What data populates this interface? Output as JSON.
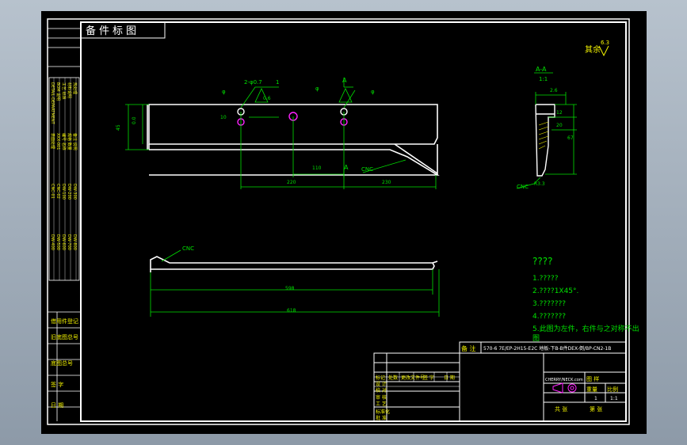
{
  "stamp": {
    "text": "备件标图"
  },
  "roughness": {
    "label": "其余",
    "value": "6.3"
  },
  "section": {
    "title": "A-A",
    "scale": "1:1"
  },
  "dims_top": {
    "d1": "2-φ0.7",
    "d2": "1",
    "tol1": "φ",
    "tol2": "φ",
    "tol3": "φ",
    "sec_a_top": "A",
    "sec_a_bottom": "A",
    "left1": "45",
    "left2": "0.0",
    "hole_v": "10",
    "dim_110": "110",
    "dim_220": "220",
    "dim_230": "230",
    "flat": "0.6",
    "cnc": "CNC"
  },
  "dims_section": {
    "w": "2.6",
    "h1": "12",
    "h2": "20",
    "h3": "67",
    "cnc": "CNC",
    "r": "R3.3"
  },
  "dims_bottom": {
    "cnc": "CNC",
    "dim_598": "598",
    "dim_618": "618"
  },
  "notes": {
    "heading": "????",
    "n1": "1.?????",
    "n2": "2.????1X45°.",
    "n3": "3.???????",
    "n4": "4.???????",
    "n5a": "5.此图为左件，右件与之对称不出",
    "n5b": "图"
  },
  "title_block": {
    "ref_label": "备 注",
    "ref_text": "570-6  7E/EP-2H15-E2C 地板-下B-B件DEX-倒/BP-CN2-1B",
    "company": "CHERRY/NECK.com",
    "header_cells": [
      "标记",
      "处数",
      "更改文件号",
      "签 字",
      "日 期"
    ],
    "left_rows": [
      "设 计",
      "校 对",
      "审 核",
      "工 艺",
      "标准化",
      "批 准"
    ],
    "mat": "图 样",
    "weight": "重量",
    "scale_label": "比例",
    "qty": "1",
    "scale": "1:1",
    "sheet": "共 张",
    "sheet2": "第 张"
  },
  "side_strip": {
    "labels": [
      "借用件登记",
      "旧底图总号",
      "底图总号",
      "签 字",
      "日 期"
    ],
    "table_rows": [
      "DETAIL-DEPARTMENT",
      "BOM 说明",
      "工艺 标准",
      "材料说明",
      "热处理",
      "表面处理",
      "XXX-001",
      "编号 名称",
      "规格 数量",
      "备注 说明",
      "CNC-01",
      "CNC-02",
      "DW-100",
      "DW-200",
      "DW-300",
      "DW-400",
      "DW-500",
      "DW-600",
      "DW-700",
      "DW-800"
    ]
  }
}
